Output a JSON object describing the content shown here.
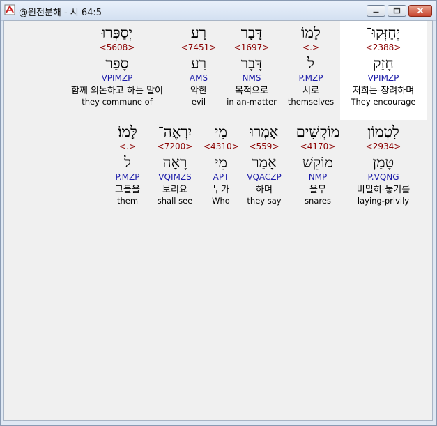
{
  "window": {
    "title": "@원전분해 - 시 64:5",
    "controls": {
      "minimize": "minimize-icon",
      "maximize": "maximize-icon",
      "close": "close-icon"
    },
    "colors": {
      "strong": "#8b0000",
      "morph": "#1a1aa8",
      "highlight": "#ffffff"
    }
  },
  "rows": [
    {
      "words": [
        {
          "hebrew": "יְחַזְּקוּ־",
          "strong": "<2388>",
          "lemma": "חָזַק",
          "morph": "VPIMZP",
          "korean": "저희는-장려하며",
          "english": "They encourage",
          "selected": true
        },
        {
          "hebrew": "לָמוֹ",
          "strong": "<.>",
          "lemma": "ל",
          "morph": "P.MZP",
          "korean": "서로",
          "english": "themselves",
          "selected": false
        },
        {
          "hebrew": "דָּבָר",
          "strong": "<1697>",
          "lemma": "דָּבָר",
          "morph": "NMS",
          "korean": "목적으로",
          "english": "in an-matter",
          "selected": false
        },
        {
          "hebrew": "רָע",
          "strong": "<7451>",
          "lemma": "רַע",
          "morph": "AMS",
          "korean": "악한",
          "english": "evil",
          "selected": false
        },
        {
          "hebrew": "יְסַפְּרוּ",
          "strong": "<5608>",
          "lemma": "סָפַר",
          "morph": "VPIMZP",
          "korean": "함께 의논하고 하는 말이",
          "english": "they commune of",
          "selected": false
        }
      ]
    },
    {
      "words": [
        {
          "hebrew": "לִטְמוֹן",
          "strong": "<2934>",
          "lemma": "טָמַן",
          "morph": "P.VQNG",
          "korean": "비밀히-놓기를",
          "english": "laying-privily",
          "selected": false
        },
        {
          "hebrew": "מוֹקְשִׁים",
          "strong": "<4170>",
          "lemma": "מוֹקֵשׁ",
          "morph": "NMP",
          "korean": "올무",
          "english": "snares",
          "selected": false
        },
        {
          "hebrew": "אָמְרוּ",
          "strong": "<559>",
          "lemma": "אָמַר",
          "morph": "VQACZP",
          "korean": "하며",
          "english": "they say",
          "selected": false
        },
        {
          "hebrew": "מִי",
          "strong": "<4310>",
          "lemma": "מִי",
          "morph": "APT",
          "korean": "누가",
          "english": "Who",
          "selected": false
        },
        {
          "hebrew": "יִרְאֶה־",
          "strong": "<7200>",
          "lemma": "רָאָה",
          "morph": "VQIMZS",
          "korean": "보리요",
          "english": "shall see",
          "selected": false
        },
        {
          "hebrew": "לָּמוֹ׃",
          "strong": "<.>",
          "lemma": "ל",
          "morph": "P.MZP",
          "korean": "그들을",
          "english": "them",
          "selected": false
        }
      ]
    }
  ]
}
